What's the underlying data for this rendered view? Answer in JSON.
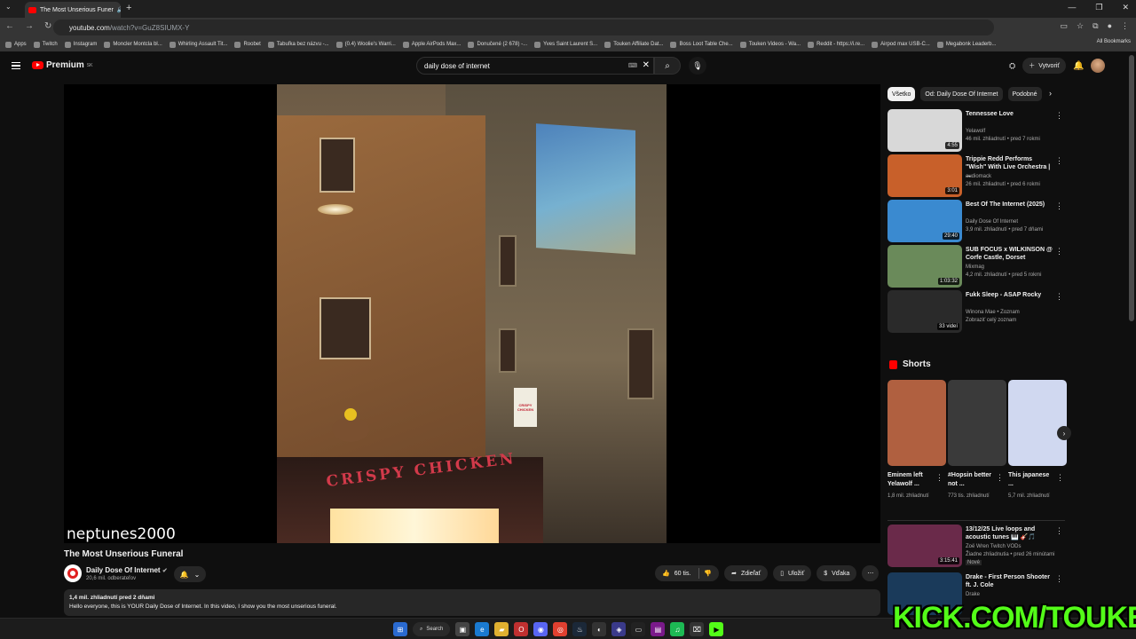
{
  "browser": {
    "tab_title": "The Most Unserious Funer",
    "url_host": "youtube.com",
    "url_path": "/watch?v=GuZ8SIUMX-Y",
    "bookmarks": [
      "Apps",
      "Twitch",
      "Instagram",
      "Moncler Montcla bl...",
      "Whirling Assault Tit...",
      "Roobet",
      "Tabuľka bez názvu -...",
      "(0.4) Woolie's Warri...",
      "Apple AirPods Max...",
      "Donučené (2 678) -...",
      "Yves Saint Laurent S...",
      "Touken Affiliate Dat...",
      "Boss Loot Table Che...",
      "Touken Videos - Wa...",
      "Reddit - https://i.re...",
      "Airpod max USB-C...",
      "Megabonk Leaderb..."
    ],
    "all_bookmarks": "All Bookmarks"
  },
  "header": {
    "logo_text": "Premium",
    "logo_sup": "SK",
    "search_value": "daily dose of internet",
    "create_label": "Vytvoriť"
  },
  "video": {
    "watermark": "neptunes2000",
    "sign_text": "CRISPY CHICKEN",
    "store_text": "CRISPY CHICKEN",
    "title": "The Most Unserious Funeral",
    "channel": "Daily Dose Of Internet",
    "subscribers": "20,6 mil. odberateľov",
    "likes": "60 tis.",
    "share": "Zdieľať",
    "save": "Uložiť",
    "thanks": "Vďaka",
    "views_date": "1,4 mil. zhliadnutí  pred 2 dňami",
    "description": "Hello everyone, this is YOUR Daily Dose of Internet. In this video, I show you the most unserious funeral."
  },
  "chips": [
    "Všetko",
    "Od: Daily Dose Of Internet",
    "Podobné"
  ],
  "recommendations": [
    {
      "title": "Tennessee Love",
      "channel": "Yelawolf",
      "meta": "46 mil. zhliadnutí • pred 7 rokmi",
      "duration": "4:55",
      "color": "#d8d8d8"
    },
    {
      "title": "Trippie Redd Performs \"Wish\" With Live Orchestra | ...",
      "channel": "audiomack",
      "meta": "26 mil. zhliadnutí • pred 6 rokmi",
      "duration": "3:01",
      "color": "#c8602a"
    },
    {
      "title": "Best Of The Internet (2025)",
      "channel": "Daily Dose Of Internet",
      "meta": "3,9 mil. zhliadnutí • pred 7 dňami",
      "duration": "29:40",
      "color": "#3a8ad0"
    },
    {
      "title": "SUB FOCUS x WILKINSON @ Corfe Castle, Dorset",
      "channel": "Mixmag",
      "meta": "4,2 mil. zhliadnutí • pred 5 rokmi",
      "duration": "1:03:32",
      "color": "#6a8a5a"
    },
    {
      "title": "Fukk Sleep - ASAP Rocky",
      "channel": "Winona Mae • Zoznam",
      "meta": "Zobraziť celý zoznam",
      "duration": "33 videí",
      "color": "#2a2a2a"
    }
  ],
  "shorts": {
    "heading": "Shorts",
    "items": [
      {
        "title": "Eminem left Yelawolf ...",
        "views": "1,8 mil. zhliadnutí",
        "color": "#b06040"
      },
      {
        "title": "#Hopsin better not ...",
        "views": "773 tis. zhliadnutí",
        "color": "#3a3a3a"
      },
      {
        "title": "This japanese ...",
        "views": "5,7 mil. zhliadnutí",
        "color": "#d0d8f0"
      }
    ]
  },
  "more_recs": [
    {
      "title": "13/12/25 Live loops and acoustic tunes 🎹 🎸🎵",
      "channel": "Zoë Wren Twitch VODs",
      "meta": "Žiadne zhliadnutia • pred 26 minútami",
      "badge": "Nové",
      "duration": "3:15:41",
      "color": "#6a2a4a"
    },
    {
      "title": "Drake - First Person Shooter ft. J. Cole",
      "channel": "Drake",
      "meta": "",
      "badge": "",
      "duration": "",
      "color": "#1a3a5a"
    }
  ],
  "taskbar": {
    "search_label": "Search"
  },
  "overlay": {
    "kick_text": "KICK.COM/TOUKEN"
  }
}
